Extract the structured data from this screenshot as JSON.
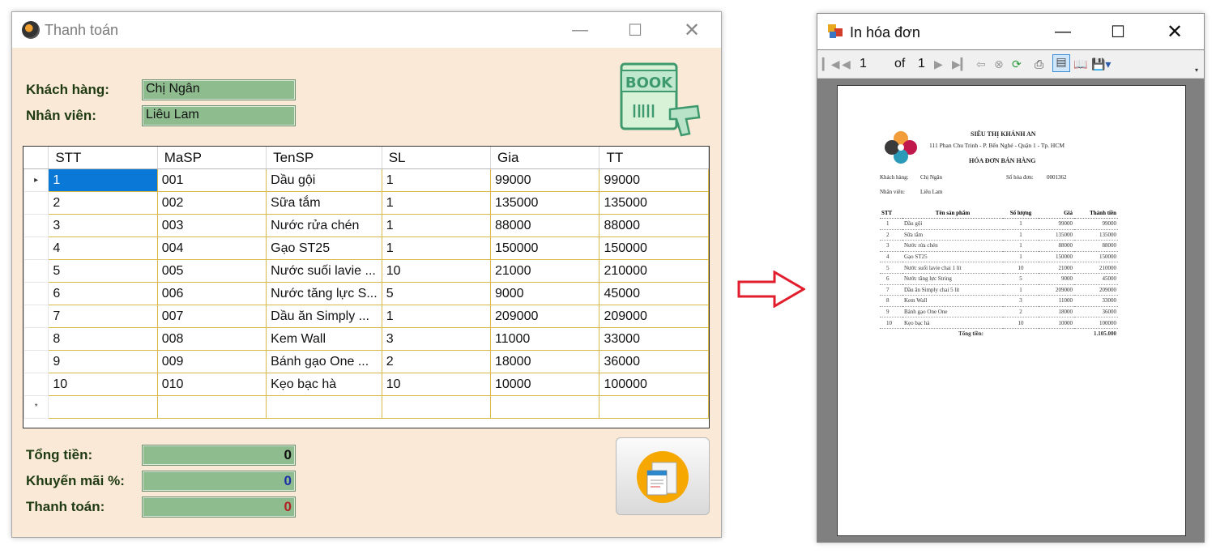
{
  "window1": {
    "title": "Thanh toán",
    "customer_label": "Khách hàng:",
    "customer_value": "Chị Ngân",
    "staff_label": "Nhân viên:",
    "staff_value": "Liêu Lam",
    "book_icon_text": "BOOK",
    "grid": {
      "columns": [
        "STT",
        "MaSP",
        "TenSP",
        "SL",
        "Gia",
        "TT"
      ],
      "rows": [
        [
          "1",
          "001",
          "Dầu gội",
          "1",
          "99000",
          "99000"
        ],
        [
          "2",
          "002",
          "Sữa tắm",
          "1",
          "135000",
          "135000"
        ],
        [
          "3",
          "003",
          "Nước rửa chén",
          "1",
          "88000",
          "88000"
        ],
        [
          "4",
          "004",
          "Gạo ST25",
          "1",
          "150000",
          "150000"
        ],
        [
          "5",
          "005",
          "Nước suối lavie ...",
          "10",
          "21000",
          "210000"
        ],
        [
          "6",
          "006",
          "Nước tăng lực S...",
          "5",
          "9000",
          "45000"
        ],
        [
          "7",
          "007",
          "Dầu ăn Simply ...",
          "1",
          "209000",
          "209000"
        ],
        [
          "8",
          "008",
          "Kem Wall",
          "3",
          "11000",
          "33000"
        ],
        [
          "9",
          "009",
          "Bánh gạo One ...",
          "2",
          "18000",
          "36000"
        ],
        [
          "10",
          "010",
          "Kẹo bạc hà",
          "10",
          "10000",
          "100000"
        ]
      ],
      "current_row_marker": "▸",
      "new_row_marker": "*"
    },
    "total_label": "Tổng tiền:",
    "total_value": "0",
    "discount_label": "Khuyến mãi %:",
    "discount_value": "0",
    "pay_label": "Thanh toán:",
    "pay_value": "0",
    "colors": {
      "background": "#fae9d6",
      "field": "#8fbc8f",
      "selection": "#0a78d7",
      "discount_value": "#1f2fa8",
      "pay_value": "#b22222"
    }
  },
  "window2": {
    "title": "In hóa đơn",
    "page_current": "1",
    "page_of": "of",
    "page_total": "1",
    "report": {
      "store_name": "SIÊU THỊ KHÁNH AN",
      "address": "111 Phan Chu Trinh - P. Bến Nghé - Quận 1 - Tp. HCM",
      "heading": "HÓA ĐƠN BÁN HÀNG",
      "customer_label": "Khách hàng:",
      "customer_value": "Chị Ngân",
      "invoice_label": "Số hóa đơn:",
      "invoice_value": "0001362",
      "staff_label": "Nhân viên:",
      "staff_value": "Liêu Lam",
      "columns": [
        "STT",
        "Tên sản phẩm",
        "Số lượng",
        "Giá",
        "Thành tiền"
      ],
      "rows": [
        [
          "1",
          "Dầu gội",
          "1",
          "99000",
          "99000"
        ],
        [
          "2",
          "Sữa tắm",
          "1",
          "135000",
          "135000"
        ],
        [
          "3",
          "Nước rửa chén",
          "1",
          "88000",
          "88000"
        ],
        [
          "4",
          "Gạo ST25",
          "1",
          "150000",
          "150000"
        ],
        [
          "5",
          "Nước suối lavie chai 1 lít",
          "10",
          "21000",
          "210000"
        ],
        [
          "6",
          "Nước tăng lực String",
          "5",
          "9000",
          "45000"
        ],
        [
          "7",
          "Dầu ăn Simply chai 5 lít",
          "1",
          "209000",
          "209000"
        ],
        [
          "8",
          "Kem Wall",
          "3",
          "11000",
          "33000"
        ],
        [
          "9",
          "Bánh gạo One One",
          "2",
          "18000",
          "36000"
        ],
        [
          "10",
          "Kẹo bạc hà",
          "10",
          "10000",
          "100000"
        ]
      ],
      "total_label": "Tổng tiền:",
      "total_value": "1.105.000"
    }
  },
  "icons": [
    "app-icon",
    "minimize-icon",
    "maximize-icon",
    "close-icon",
    "book-barcode-icon",
    "print-invoice-icon",
    "right-arrow-icon",
    "report-viewer-icon",
    "first-page-icon",
    "prev-page-icon",
    "next-page-icon",
    "last-page-icon",
    "back-icon",
    "stop-icon",
    "refresh-icon",
    "print-icon",
    "print-layout-icon",
    "page-setup-icon",
    "export-icon",
    "store-logo-icon"
  ]
}
